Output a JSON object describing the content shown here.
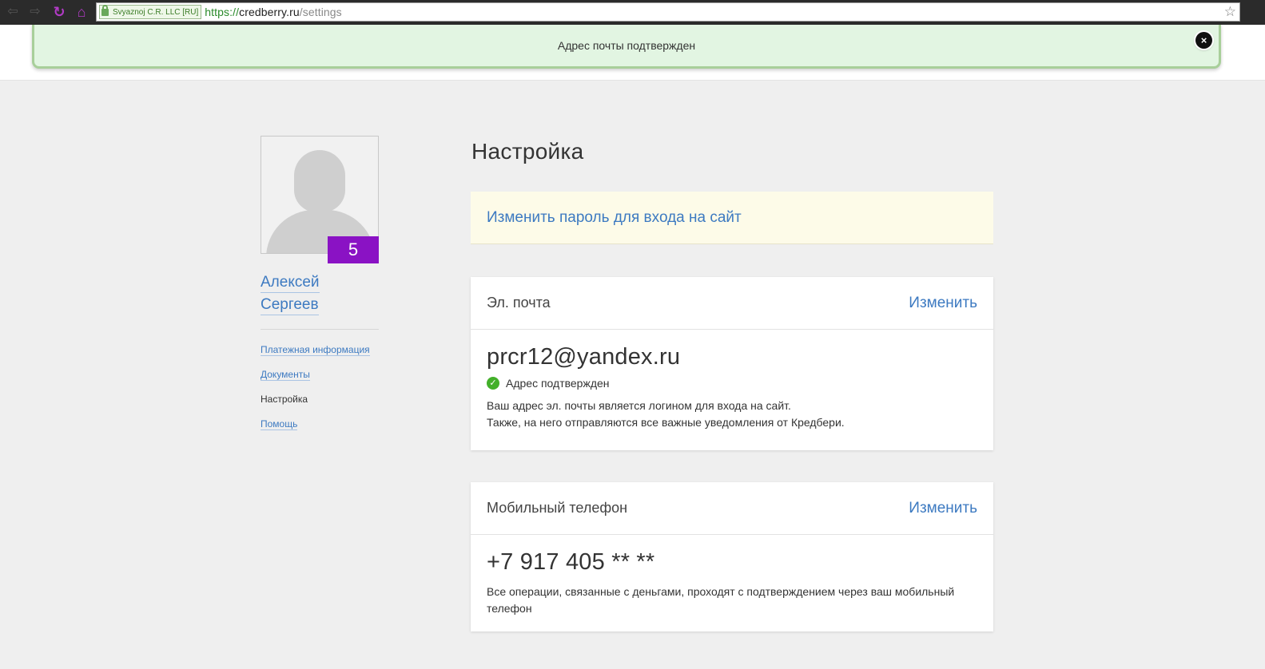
{
  "browser": {
    "cert_label": "Svyaznoj C.R. LLC [RU]",
    "url_scheme": "https://",
    "url_host": "credberry.ru",
    "url_path": "/settings"
  },
  "notification": {
    "message": "Адрес почты подтвержден",
    "close_label": "×"
  },
  "profile": {
    "level": "5",
    "first_name": "Алексей",
    "last_name": "Сергеев"
  },
  "sidebar": {
    "items": [
      {
        "label": "Платежная информация",
        "active": false
      },
      {
        "label": "Документы",
        "active": false
      },
      {
        "label": "Настройка",
        "active": true
      },
      {
        "label": "Помощь",
        "active": false
      }
    ]
  },
  "main": {
    "title": "Настройка",
    "password_link": "Изменить пароль для входа на сайт",
    "email_card": {
      "header": "Эл. почта",
      "change_label": "Изменить",
      "value": "prcr12@yandex.ru",
      "status": "Адрес подтвержден",
      "note_line1": "Ваш адрес эл. почты является логином для входа на сайт.",
      "note_line2": "Также, на него отправляются все важные уведомления от Кредбери."
    },
    "phone_card": {
      "header": "Мобильный телефон",
      "change_label": "Изменить",
      "value": "+7 917 405 ** **",
      "note": "Все операции, связанные с деньгами, проходят с подтверждением через ваш мобильный телефон"
    }
  },
  "colors": {
    "accent_link": "#3d7ac1",
    "level_badge": "#8a12c4",
    "notice_bg": "#e2f5e2",
    "verified_green": "#43b02a"
  },
  "icons": {
    "back": "arrow-left-icon",
    "forward": "arrow-right-icon",
    "reload": "reload-icon",
    "home": "home-icon",
    "lock": "lock-icon",
    "star": "star-icon",
    "close": "close-icon",
    "check": "check-icon"
  }
}
